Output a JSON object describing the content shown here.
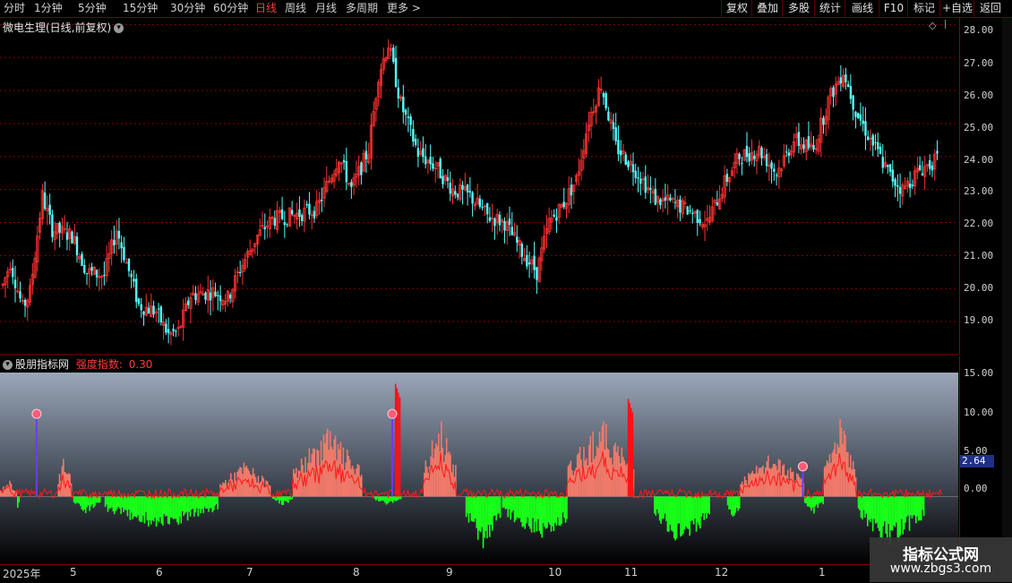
{
  "toolbar": {
    "periods": [
      "分时",
      "1分钟",
      "5分钟",
      "15分钟",
      "30分钟",
      "60分钟",
      "日线",
      "周线",
      "月线",
      "多周期",
      "更多 >"
    ],
    "active_period": "日线",
    "buttons": [
      "复权",
      "叠加",
      "多股",
      "统计",
      "画线",
      "F10",
      "标记",
      "+自选",
      "返回"
    ]
  },
  "price_panel": {
    "title": "微电生理(日线,前复权)",
    "axis_ticks": [
      "28.00",
      "27.00",
      "26.00",
      "25.00",
      "24.00",
      "23.00",
      "22.00",
      "21.00",
      "20.00",
      "19.00"
    ]
  },
  "indicator_panel": {
    "title": "股朋指标网",
    "indicator_name": "强度指数:",
    "indicator_value": "0.30",
    "axis_ticks": [
      "15.00",
      "10.00",
      "5.00",
      "0.00"
    ],
    "value_tag": "2.64"
  },
  "time_axis": [
    "2025年",
    "5",
    "6",
    "7",
    "8",
    "9",
    "10",
    "11",
    "12",
    "1"
  ],
  "watermark": {
    "title": "指标公式网",
    "url": "www.zbgs3.com"
  },
  "colors": {
    "up": "#ff3232",
    "down": "#54ffff",
    "bar_pos": "#f07a6a",
    "bar_neg": "#18ff18",
    "signal": "#ff1a1a",
    "grid": "#8b0000"
  },
  "chart_data": [
    {
      "type": "candlestick",
      "ylim": [
        18,
        28.2
      ],
      "anchors": [
        [
          0,
          20.1
        ],
        [
          6,
          20.8
        ],
        [
          16,
          19.4
        ],
        [
          22,
          19.9
        ],
        [
          32,
          22.8
        ],
        [
          40,
          21.8
        ],
        [
          56,
          21.6
        ],
        [
          68,
          20.5
        ],
        [
          82,
          20.4
        ],
        [
          92,
          21.8
        ],
        [
          110,
          19.5
        ],
        [
          124,
          19.3
        ],
        [
          134,
          18.6
        ],
        [
          142,
          18.7
        ],
        [
          152,
          19.8
        ],
        [
          170,
          19.9
        ],
        [
          182,
          19.7
        ],
        [
          192,
          20.6
        ],
        [
          206,
          21.6
        ],
        [
          218,
          22.1
        ],
        [
          232,
          22.2
        ],
        [
          254,
          22.4
        ],
        [
          272,
          24.0
        ],
        [
          282,
          23.0
        ],
        [
          296,
          24.2
        ],
        [
          304,
          26.5
        ],
        [
          312,
          27.4
        ],
        [
          322,
          25.6
        ],
        [
          336,
          24.1
        ],
        [
          350,
          23.7
        ],
        [
          364,
          23.0
        ],
        [
          378,
          22.8
        ],
        [
          392,
          22.2
        ],
        [
          406,
          22.0
        ],
        [
          420,
          21.1
        ],
        [
          432,
          20.5
        ],
        [
          442,
          22.0
        ],
        [
          454,
          22.6
        ],
        [
          464,
          23.3
        ],
        [
          474,
          25.1
        ],
        [
          484,
          26.2
        ],
        [
          496,
          24.3
        ],
        [
          512,
          23.6
        ],
        [
          528,
          22.7
        ],
        [
          540,
          22.6
        ],
        [
          554,
          22.4
        ],
        [
          570,
          22.0
        ],
        [
          584,
          23.2
        ],
        [
          596,
          24.0
        ],
        [
          612,
          24.2
        ],
        [
          626,
          23.5
        ],
        [
          640,
          24.5
        ],
        [
          656,
          24.2
        ],
        [
          668,
          25.7
        ],
        [
          680,
          26.6
        ],
        [
          690,
          25.4
        ],
        [
          698,
          24.8
        ],
        [
          708,
          24.1
        ],
        [
          718,
          23.4
        ],
        [
          728,
          23.0
        ],
        [
          742,
          23.6
        ],
        [
          756,
          23.9
        ]
      ]
    },
    {
      "type": "bar",
      "ylim": [
        -9,
        16.5
      ],
      "positive_segments": [
        [
          0,
          12,
          2
        ],
        [
          44,
          54,
          5
        ],
        [
          168,
          206,
          4
        ],
        [
          224,
          276,
          8
        ],
        [
          324,
          348,
          9
        ],
        [
          434,
          484,
          9
        ],
        [
          566,
          614,
          5
        ],
        [
          630,
          654,
          9
        ]
      ],
      "strong_red_bars": [
        [
          302,
          15
        ],
        [
          480,
          13
        ]
      ],
      "negative_segments": [
        [
          8,
          14,
          -3
        ],
        [
          56,
          76,
          -2
        ],
        [
          80,
          166,
          -4
        ],
        [
          208,
          224,
          -1
        ],
        [
          286,
          306,
          -1
        ],
        [
          330,
          348,
          -7
        ],
        [
          356,
          382,
          -6
        ],
        [
          384,
          442,
          -5
        ],
        [
          500,
          542,
          -6
        ],
        [
          556,
          566,
          -3
        ],
        [
          614,
          630,
          -2
        ],
        [
          656,
          706,
          -6
        ]
      ],
      "signal_line": "强度指数",
      "markers": [
        {
          "kind": "purple-line",
          "x": 28,
          "top": 11
        },
        {
          "kind": "purple-line",
          "x": 300,
          "top": 11
        },
        {
          "kind": "purple-line",
          "x": 614,
          "top": 4
        }
      ]
    }
  ]
}
